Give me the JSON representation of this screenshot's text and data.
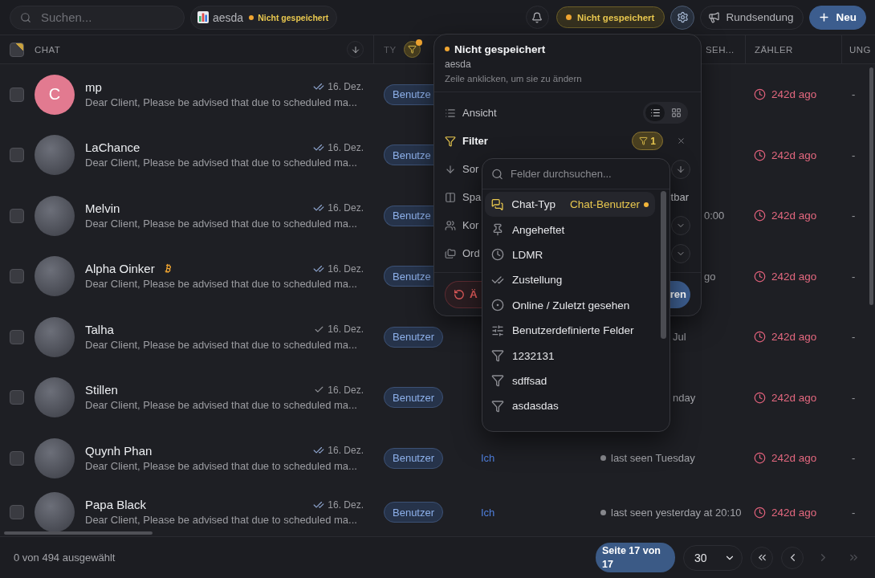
{
  "topbar": {
    "search": {
      "placeholder": "Suchen..."
    },
    "view_chip": {
      "name": "aesda",
      "status": "Nicht gespeichert"
    },
    "status_pill": "Nicht gespeichert",
    "settings": {
      "selected": true
    },
    "broadcast": "Rundsendung",
    "new": "Neu"
  },
  "table": {
    "header": {
      "select_all": {
        "checked": false
      },
      "chat": "CHAT",
      "type": "TY",
      "type_filter": {
        "active": true
      },
      "last_seen": "SEH...",
      "counter": "ZÄHLER",
      "column_7": "UNG"
    },
    "rows": [
      {
        "selected": false,
        "avatar": {
          "kind": "initial",
          "initial": "C",
          "color": "#e27a90"
        },
        "name": "mp",
        "coin_badge": false,
        "read": true,
        "date": "16. Dez.",
        "preview": "Dear Client, Please be advised that due to scheduled ma...",
        "type": "Benutze",
        "counter": "242d ago",
        "column_7": "-"
      },
      {
        "selected": false,
        "avatar": {
          "kind": "photo"
        },
        "name": "LaChance",
        "coin_badge": false,
        "read": true,
        "date": "16. Dez.",
        "preview": "Dear Client, Please be advised that due to scheduled ma...",
        "type": "Benutze",
        "counter": "242d ago",
        "column_7": "-"
      },
      {
        "selected": false,
        "avatar": {
          "kind": "photo"
        },
        "name": "Melvin",
        "coin_badge": false,
        "read": true,
        "date": "16. Dez.",
        "preview": "Dear Client, Please be advised that due to scheduled ma...",
        "type": "Benutze",
        "last_seen": {
          "kind": "tail",
          "text": "0:00"
        },
        "counter": "242d ago",
        "column_7": "-"
      },
      {
        "selected": false,
        "avatar": {
          "kind": "photo"
        },
        "name": "Alpha Oinker",
        "coin_badge": true,
        "read": true,
        "date": "16. Dez.",
        "preview": "Dear Client, Please be advised that due to scheduled ma...",
        "type": "Benutze",
        "last_seen": {
          "kind": "tail",
          "text": "go"
        },
        "counter": "242d ago",
        "column_7": "-"
      },
      {
        "selected": false,
        "avatar": {
          "kind": "photo"
        },
        "name": "Talha",
        "coin_badge": false,
        "read": false,
        "date": "16. Dez.",
        "preview": "Dear Client, Please be advised that due to scheduled ma...",
        "type": "Benutzer",
        "last_seen": {
          "kind": "tail",
          "text": "Jul"
        },
        "counter": "242d ago",
        "column_7": "-"
      },
      {
        "selected": false,
        "avatar": {
          "kind": "photo"
        },
        "name": "Stillen",
        "coin_badge": false,
        "read": false,
        "date": "16. Dez.",
        "preview": "Dear Client, Please be advised that due to scheduled ma...",
        "type": "Benutzer",
        "last_seen": {
          "kind": "tail",
          "text": "nday"
        },
        "counter": "242d ago",
        "column_7": "-"
      },
      {
        "selected": false,
        "avatar": {
          "kind": "photo"
        },
        "name": "Quynh Phan",
        "coin_badge": false,
        "read": true,
        "date": "16. Dez.",
        "preview": "Dear Client, Please be advised that due to scheduled ma...",
        "type": "Benutzer",
        "assignee": "Ich",
        "last_seen": {
          "kind": "full",
          "text": "last seen Tuesday"
        },
        "counter": "242d ago",
        "column_7": "-"
      },
      {
        "selected": false,
        "avatar": {
          "kind": "photo"
        },
        "name": "Papa Black",
        "coin_badge": false,
        "read": true,
        "date": "16. Dez.",
        "preview": "Dear Client, Please be advised that due to scheduled ma...",
        "type": "Benutzer",
        "assignee": "Ich",
        "last_seen": {
          "kind": "full",
          "text": "last seen yesterday at 20:10"
        },
        "counter": "242d ago",
        "column_7": "-"
      }
    ]
  },
  "view_popover": {
    "title": "Nicht gespeichert",
    "view_name": "aesda",
    "hint": "Zeile anklicken, um sie zu ändern",
    "rows": [
      {
        "kind": "view",
        "label": "Ansicht",
        "active": false,
        "modes": [
          {
            "kind": "list",
            "selected": true
          },
          {
            "kind": "grid",
            "selected": false
          }
        ]
      },
      {
        "kind": "filter",
        "label": "Filter",
        "active": true,
        "count": "1"
      },
      {
        "kind": "sort",
        "label": "Sor",
        "active": false
      },
      {
        "kind": "columns",
        "label": "Spa",
        "active": false,
        "value": "tbar"
      },
      {
        "kind": "contacts",
        "label": "Kor",
        "active": false
      },
      {
        "kind": "folders",
        "label": "Ord",
        "active": false
      }
    ],
    "reset_button": "Ä",
    "primary_button": "ren"
  },
  "field_dropdown": {
    "placeholder": "Felder durchsuchen...",
    "items": [
      {
        "kind": "chat_type",
        "label": "Chat-Typ",
        "value": "Chat-Benutzer",
        "selected": true
      },
      {
        "kind": "pin",
        "label": "Angeheftet",
        "selected": false
      },
      {
        "kind": "clock",
        "label": "LDMR",
        "selected": false
      },
      {
        "kind": "delivery",
        "label": "Zustellung",
        "selected": false
      },
      {
        "kind": "online",
        "label": "Online / Zuletzt gesehen",
        "selected": false
      },
      {
        "kind": "custom",
        "label": "Benutzerdefinierte Felder",
        "selected": false
      },
      {
        "kind": "field",
        "label": "1232131",
        "selected": false
      },
      {
        "kind": "field",
        "label": "sdffsad",
        "selected": false
      },
      {
        "kind": "field",
        "label": "asdasdas",
        "selected": false
      }
    ]
  },
  "footer": {
    "selection": "0 von 494 ausgewählt",
    "page": "Seite 17 von 17",
    "page_size": "30",
    "pager": [
      {
        "kind": "first",
        "disabled": false
      },
      {
        "kind": "prev",
        "disabled": false
      },
      {
        "kind": "next",
        "disabled": true
      },
      {
        "kind": "last",
        "disabled": true
      }
    ]
  }
}
